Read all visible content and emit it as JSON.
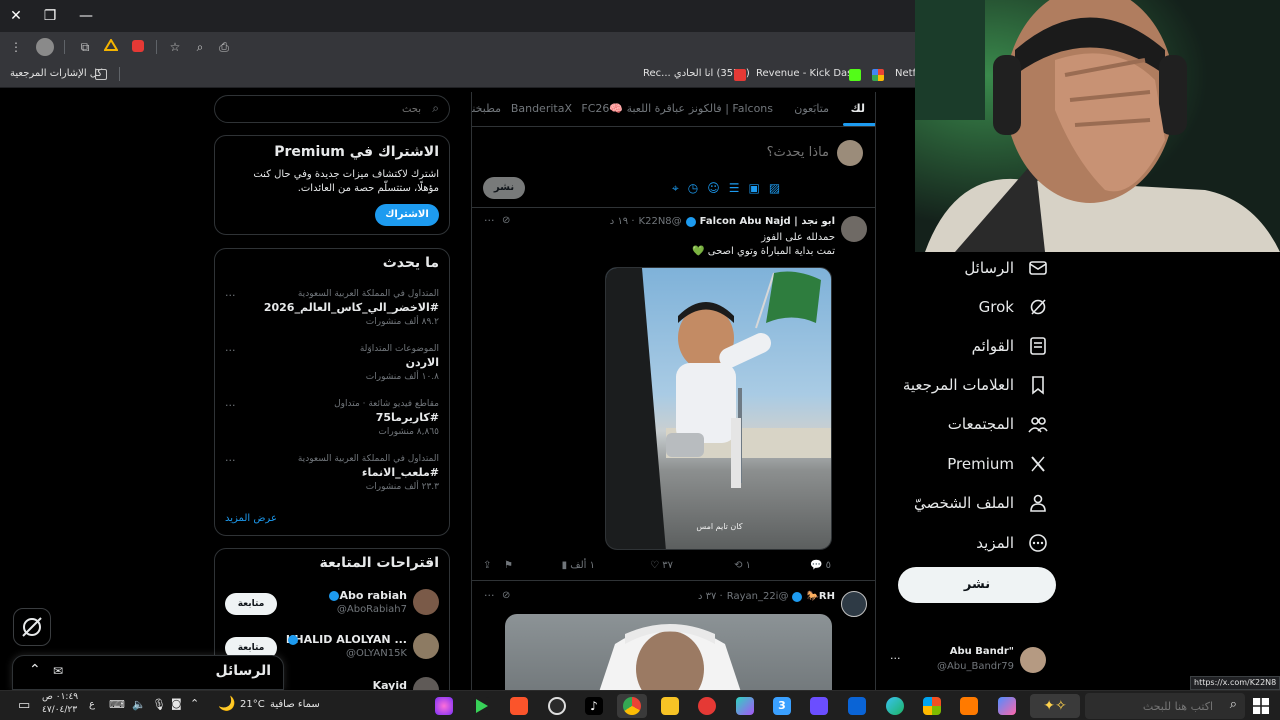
{
  "browser": {
    "bookmarks": {
      "all_bookmarks": "كل الإشارات المرجعية",
      "youtube": "(3573) انا الحادي ...Rec",
      "kick": "Revenue - Kick Das...",
      "netflix": "Netfl"
    }
  },
  "sidebar": {
    "items": [
      {
        "label": "الرسائل",
        "icon": "mail-icon"
      },
      {
        "label": "Grok",
        "icon": "grok-icon"
      },
      {
        "label": "القوائم",
        "icon": "list-icon"
      },
      {
        "label": "العلامات المرجعية",
        "icon": "bookmark-icon"
      },
      {
        "label": "المجتمعات",
        "icon": "communities-icon"
      },
      {
        "label": "Premium",
        "icon": "x-logo-icon"
      },
      {
        "label": "الملف الشخصيّ",
        "icon": "person-icon"
      },
      {
        "label": "المزيد",
        "icon": "more-circle-icon"
      }
    ],
    "post_button": "نشر",
    "account": {
      "name": "Abu Bandr\"",
      "handle": "@Abu_Bandr79",
      "more": "···"
    }
  },
  "feed": {
    "tabs": [
      "لك",
      "متابَعون",
      "فالكونز | Falcons",
      "FC26🧠 عباقرة اللعبة",
      "BanderitaX",
      "مطبخنا"
    ],
    "composer": {
      "placeholder": "ماذا يحدث؟",
      "post_label": "نشر"
    },
    "tweet1": {
      "name": "ابو نجد | Falcon Abu Najd",
      "handle": "@K22N8",
      "time": "· ١٩ د",
      "line1": "حمدلله على الفوز",
      "line2": "تمت بداية المباراة وتوي اصحى 💚",
      "image_caption": "كان تايم امس",
      "replies": "٥",
      "retweets": "١",
      "likes": "٣٧",
      "views": "١ ألف"
    },
    "tweet2": {
      "name": "RH🐎",
      "handle": "@Rayan_22i",
      "time": "· ٣٧ د"
    }
  },
  "right_col": {
    "search_placeholder": "بحث",
    "premium": {
      "title": "الاشتراك في Premium",
      "body": "اشترك لاكتشاف ميزات جديدة وفي حال كنت مؤهلًا، ستتسلّم حصة من العائدات.",
      "button": "الاشتراك"
    },
    "whats_happening": {
      "title": "ما يحدث",
      "trends": [
        {
          "meta": "المتداول في المملكة العربية السعودية",
          "name": "#الاخضر_الي_كاس_العالم_2026",
          "count": "٨٩.٢ ألف منشورات"
        },
        {
          "meta": "الموضوعات المتداوَلة",
          "name": "الاردن",
          "count": "١٠.٨ ألف منشورات"
        },
        {
          "meta": "مقاطع فيديو شائعة · متداول",
          "name": "#كاريرما75",
          "count": "٨,٨٦٥ منشورات"
        },
        {
          "meta": "المتداول في المملكة العربية السعودية",
          "name": "#ملعب_الانماء",
          "count": "٢٣.٣ ألف منشورات"
        }
      ],
      "show_more": "عرض المزيد"
    },
    "who_to_follow": {
      "title": "اقتراحات المتابعة",
      "users": [
        {
          "name": "Abo rabiah",
          "handle": "@AboRabiah7",
          "button": "متابعة"
        },
        {
          "name": "KHALID ALOLYAN ...",
          "handle": "@OLYAN15K",
          "button": "متابعة"
        },
        {
          "name": "Kayid",
          "handle": "",
          "button": ""
        }
      ]
    }
  },
  "messages_drawer": {
    "title": "الرسائل"
  },
  "status_url": "https://x.com/K22N8",
  "taskbar": {
    "search_placeholder": "اكتب هنا للبحث",
    "weather_text": "سماء صافية",
    "temperature": "21°C",
    "time": "٠١:٤٩ ص",
    "date": "٤٧/٠٤/٢٣",
    "lang": "ع"
  },
  "colors": {
    "accent": "#1d9bf0",
    "background": "#000000",
    "border": "#2f3336",
    "muted": "#71767b",
    "green_heart": "#5ac35a"
  }
}
